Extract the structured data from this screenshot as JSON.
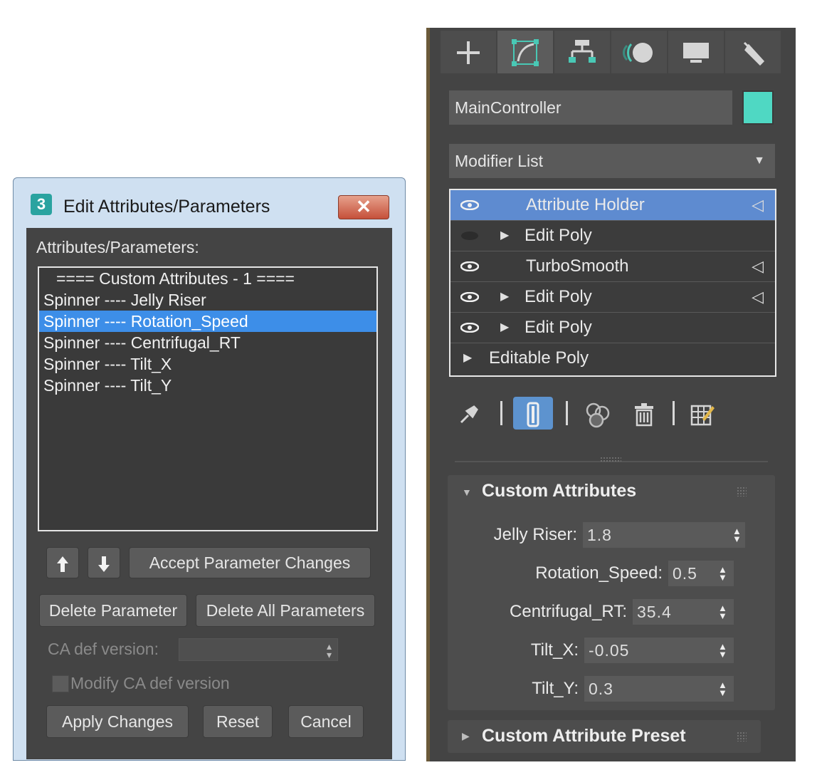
{
  "dialog": {
    "title": "Edit Attributes/Parameters",
    "app_icon_text": "3",
    "close_symbol": "✕",
    "list_label": "Attributes/Parameters:",
    "list": {
      "header": "==== Custom Attributes - 1 ====",
      "items": [
        "Spinner ---- Jelly Riser",
        "Spinner ---- Rotation_Speed",
        "Spinner ---- Centrifugal_RT",
        "Spinner ---- Tilt_X",
        "Spinner ---- Tilt_Y"
      ],
      "selected_index": 1
    },
    "move_up_icon": "arrow-up-icon",
    "move_down_icon": "arrow-down-icon",
    "accept_button": "Accept Parameter Changes",
    "delete_button": "Delete Parameter",
    "delete_all_button": "Delete All Parameters",
    "ca_def_version_label": "CA def version:",
    "modify_ca_label": "Modify CA def version",
    "apply_button": "Apply Changes",
    "reset_button": "Reset",
    "cancel_button": "Cancel"
  },
  "panel": {
    "tabs": [
      "create-icon",
      "modify-icon",
      "hierarchy-icon",
      "motion-icon",
      "display-icon",
      "utilities-icon"
    ],
    "active_tab": 1,
    "object_name": "MainController",
    "object_color": "#4fd8c3",
    "modifier_list_label": "Modifier List",
    "stack": [
      {
        "name": "Attribute Holder",
        "eye": true,
        "expand": false,
        "flag": true,
        "selected": true
      },
      {
        "name": "Edit Poly",
        "eye": false,
        "expand": true,
        "flag": false,
        "selected": false
      },
      {
        "name": "TurboSmooth",
        "eye": true,
        "expand": false,
        "flag": true,
        "selected": false
      },
      {
        "name": "Edit Poly",
        "eye": true,
        "expand": true,
        "flag": true,
        "selected": false
      },
      {
        "name": "Edit Poly",
        "eye": true,
        "expand": true,
        "flag": false,
        "selected": false
      },
      {
        "name": "Editable Poly",
        "eye": false,
        "expand": true,
        "flag": false,
        "selected": false
      }
    ],
    "toolbar": [
      "pin-stack-icon",
      "show-end-result-icon",
      "make-unique-icon",
      "remove-modifier-icon",
      "configure-sets-icon"
    ],
    "rollout_custom": {
      "title": "Custom Attributes",
      "params": [
        {
          "label": "Jelly Riser:",
          "value": "1.8"
        },
        {
          "label": "Rotation_Speed:",
          "value": "0.5"
        },
        {
          "label": "Centrifugal_RT:",
          "value": "35.4"
        },
        {
          "label": "Tilt_X:",
          "value": "-0.05"
        },
        {
          "label": "Tilt_Y:",
          "value": "0.3"
        }
      ]
    },
    "rollout_preset": {
      "title": "Custom Attribute Preset"
    }
  }
}
